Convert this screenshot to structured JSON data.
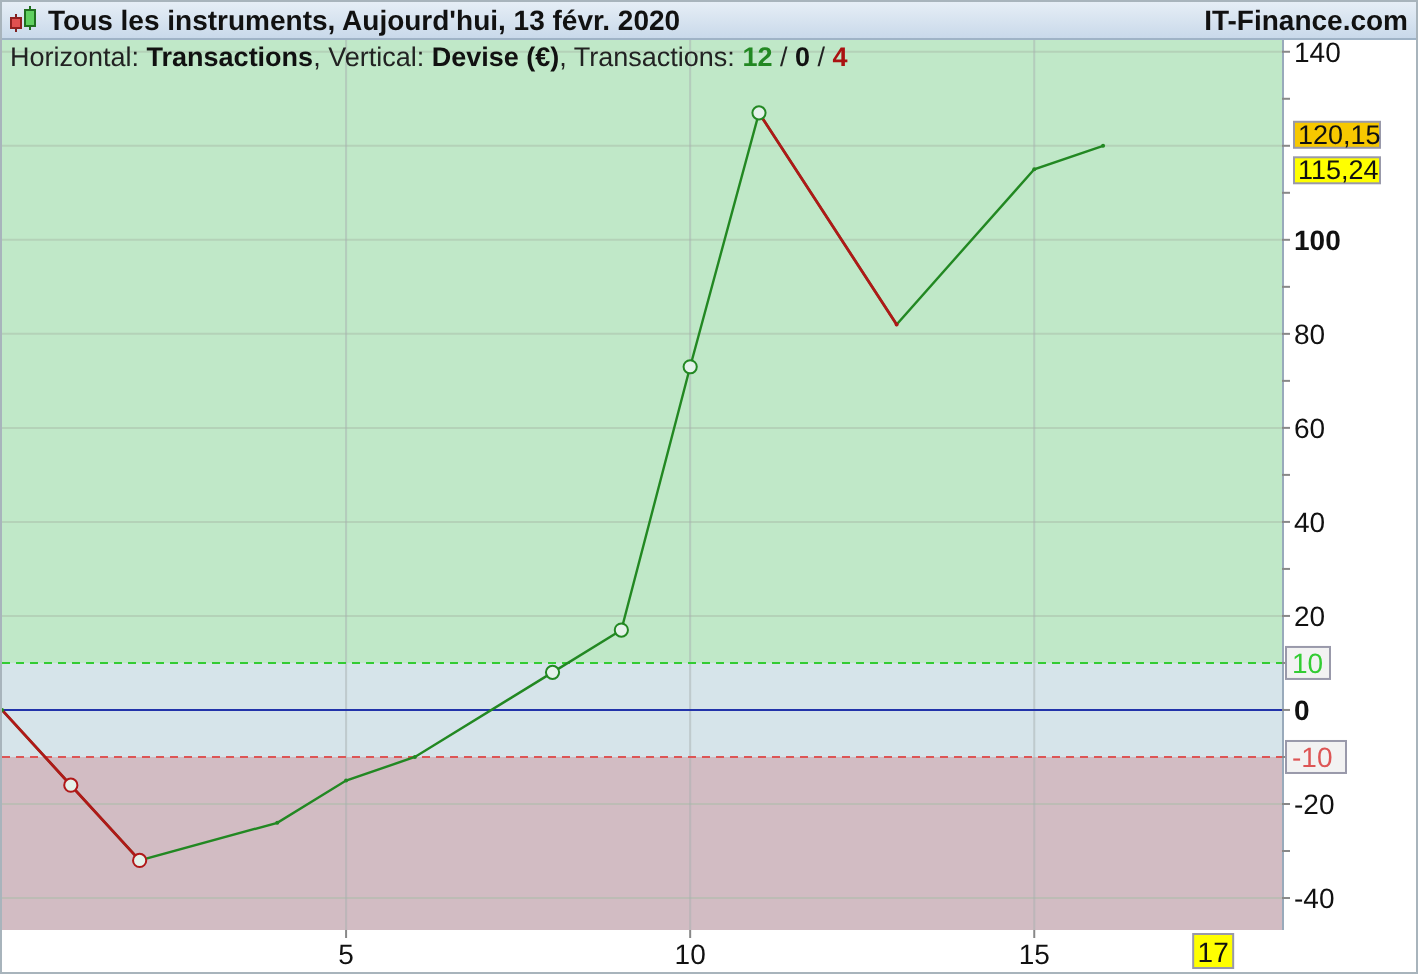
{
  "window": {
    "title": "Tous les instruments, Aujourd'hui, 13 févr. 2020",
    "brand": "IT-Finance.com"
  },
  "legend": [
    {
      "kind": "plain",
      "text": "Horizontal: "
    },
    {
      "kind": "xlabel"
    },
    {
      "kind": "plain",
      "text": ", Vertical: "
    },
    {
      "kind": "ylabel"
    },
    {
      "kind": "plain",
      "text": ", Transactions: "
    },
    {
      "kind": "win",
      "text": "12"
    },
    {
      "kind": "plain",
      "text": " / "
    },
    {
      "kind": "even",
      "text": "0"
    },
    {
      "kind": "plain",
      "text": " / "
    },
    {
      "kind": "loss",
      "text": "4"
    }
  ],
  "chart_data": {
    "type": "line",
    "xlabel": "Transactions",
    "ylabel": "Devise (€)",
    "x": [
      0,
      1,
      2,
      4,
      5,
      6,
      8,
      9,
      10,
      11,
      13,
      15,
      16
    ],
    "series": [
      {
        "color": "#228822",
        "values": [
          0,
          -16,
          -32,
          -24,
          -15,
          -10,
          8,
          17,
          73,
          127,
          82,
          115,
          120
        ]
      }
    ],
    "xlim": [
      0,
      18.6
    ],
    "ylim": [
      -46.8,
      142.5
    ],
    "xticks": [
      5,
      10,
      15
    ],
    "yticks": [
      140,
      100,
      80,
      60,
      40,
      20,
      0,
      -20,
      -40
    ],
    "grid": true,
    "bands": [
      {
        "axis": "y",
        "from": 10,
        "to": 142.5,
        "color": "#c0e8c8"
      },
      {
        "axis": "y",
        "from": -10,
        "to": 10,
        "color": "#d6e4ea"
      },
      {
        "axis": "y",
        "from": -46.8,
        "to": -10,
        "color": "#d2bcc3"
      }
    ],
    "ref_lines": [
      {
        "axis": "y",
        "value": 0,
        "color": "#2233aa"
      },
      {
        "axis": "y",
        "value": 10,
        "color": "#33cc33",
        "label": "10"
      },
      {
        "axis": "y",
        "value": -10,
        "color": "#dd5555",
        "label": "-10"
      }
    ]
  },
  "trade_markers": [
    false,
    true,
    true,
    false,
    false,
    false,
    true,
    true,
    true,
    true,
    false,
    false,
    false
  ],
  "price_tags": [
    {
      "text": "120,15",
      "color": "#f7c800"
    },
    {
      "text": "115,24",
      "color": "#ffff00"
    }
  ],
  "position_tag": {
    "text": "17",
    "color": "#ffff00"
  }
}
